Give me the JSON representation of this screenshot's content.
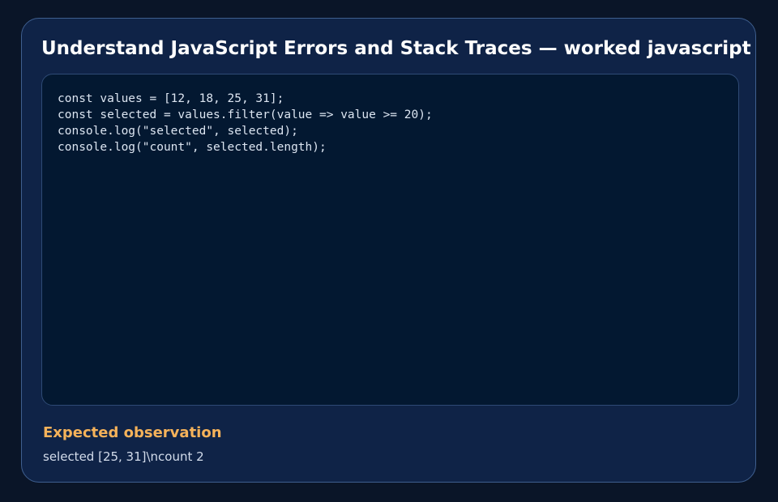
{
  "card": {
    "title": "Understand JavaScript Errors and Stack Traces — worked javascript",
    "code_lines": [
      "const values = [12, 18, 25, 31];",
      "const selected = values.filter(value => value >= 20);",
      "console.log(\"selected\", selected);",
      "console.log(\"count\", selected.length);"
    ],
    "observation_label": "Expected observation",
    "observation_text": "selected [25, 31]\\ncount 2"
  },
  "colors": {
    "page_background": "#0a1528",
    "card_background": "#0f2347",
    "card_border": "#3f5f8f",
    "code_background": "#031831",
    "title": "#ffffff",
    "code_text": "#dce5f1",
    "observation_label": "#f5b25a",
    "observation_text": "#d3dceb"
  }
}
